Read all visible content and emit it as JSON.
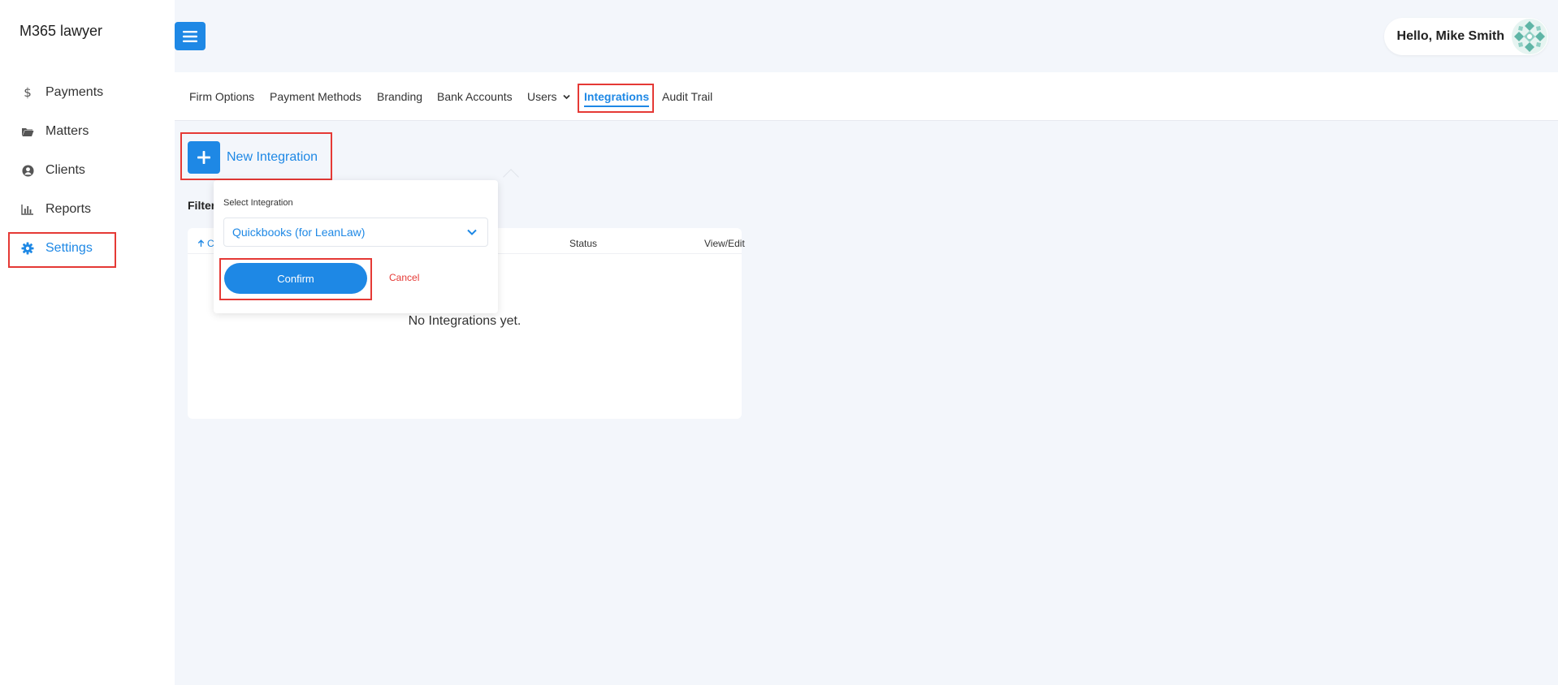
{
  "sidebar": {
    "brand": "M365 lawyer",
    "items": [
      {
        "label": "Payments",
        "icon": "dollar-icon"
      },
      {
        "label": "Matters",
        "icon": "folder-icon"
      },
      {
        "label": "Clients",
        "icon": "user-circle-icon"
      },
      {
        "label": "Reports",
        "icon": "bar-chart-icon"
      },
      {
        "label": "Settings",
        "icon": "gear-icon",
        "active": true
      }
    ]
  },
  "header": {
    "greeting": "Hello, Mike Smith"
  },
  "tabs": [
    {
      "label": "Firm Options"
    },
    {
      "label": "Payment Methods"
    },
    {
      "label": "Branding"
    },
    {
      "label": "Bank Accounts"
    },
    {
      "label": "Users"
    },
    {
      "label": "Integrations",
      "active": true
    },
    {
      "label": "Audit Trail"
    }
  ],
  "main": {
    "new_integration_label": "New Integration",
    "filter_label": "Filter",
    "table": {
      "col_first": "C",
      "col_status": "Status",
      "col_view": "View/Edit",
      "empty_message": "No Integrations yet."
    }
  },
  "popover": {
    "label": "Select Integration",
    "selected": "Quickbooks (for LeanLaw)",
    "confirm": "Confirm",
    "cancel": "Cancel"
  },
  "colors": {
    "accent": "#1e88e5",
    "highlight": "#e53935"
  }
}
